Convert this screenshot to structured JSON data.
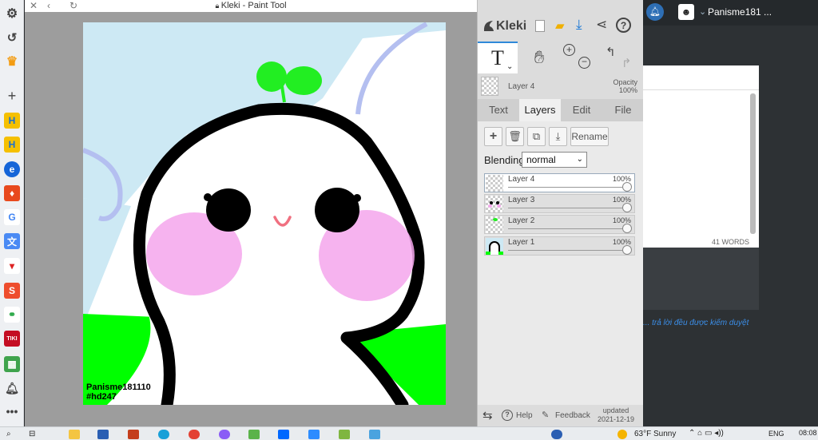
{
  "browser": {
    "title": "Kleki - Paint Tool"
  },
  "canvas": {
    "signature_line1": "Panisme181110",
    "signature_line2": "#hd247"
  },
  "kleki": {
    "logo": "Kleki",
    "current_layer": "Layer 4",
    "opacity_label": "Opacity",
    "opacity_value": "100%",
    "tabs": [
      "Text",
      "Layers",
      "Edit",
      "File"
    ],
    "active_tab": "Layers",
    "rename_label": "Rename",
    "blending_label": "Blending",
    "blending_value": "normal",
    "layers": [
      {
        "name": "Layer 4",
        "opacity": "100%",
        "selected": true
      },
      {
        "name": "Layer 3",
        "opacity": "100%",
        "selected": false
      },
      {
        "name": "Layer 2",
        "opacity": "100%",
        "selected": false
      },
      {
        "name": "Layer 1",
        "opacity": "100%",
        "selected": false
      }
    ],
    "help_label": "Help",
    "feedback_label": "Feedback",
    "updated_label": "updated",
    "updated_date": "2021-12-19"
  },
  "right_window": {
    "username": "Panisme181 ...",
    "word_count": "41 WORDS",
    "note": "... trả lời đều được kiểm duyệt"
  },
  "taskbar": {
    "weather": "63°F Sunny",
    "language": "ENG",
    "time": "08:08"
  },
  "colors": {
    "sky": "#cde9f4",
    "grass": "#00ff00",
    "blush": "#f5a6ec",
    "sprout": "#22ee22",
    "accent": "#2f89d9"
  }
}
